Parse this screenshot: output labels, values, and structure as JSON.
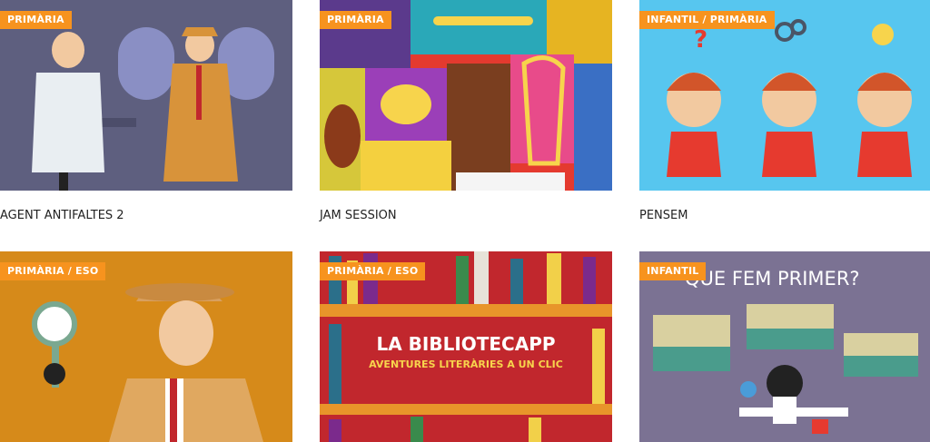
{
  "cards": [
    {
      "title": "AGENT ANTIFALTES 2",
      "badge": "PRIMÀRIA",
      "image_icon": "scientist-and-detective-illustration",
      "background": "#5e5f7f"
    },
    {
      "title": "JAM SESSION",
      "badge": "PRIMÀRIA",
      "image_icon": "musical-instruments-collage",
      "background": "#e43a2f"
    },
    {
      "title": "PENSEM",
      "badge": "INFANTIL / PRIMÀRIA",
      "image_icon": "thinking-boy-illustration",
      "background": "#57c6ef"
    },
    {
      "title": "",
      "badge": "PRIMÀRIA / ESO",
      "image_icon": "detective-with-magnifier-illustration",
      "background": "#d68a1a"
    },
    {
      "title": "",
      "badge": "PRIMÀRIA / ESO",
      "image_icon": "bookshelf-illustration",
      "background": "#c1272d",
      "image_title": "LA BIBLIOTECAPP",
      "image_subtitle": "AVENTURES LITERÀRIES A UN CLIC"
    },
    {
      "title": "",
      "badge": "INFANTIL",
      "image_icon": "kid-at-desk-illustration",
      "background": "#7b7293",
      "image_title": "QUE FEM PRIMER?"
    }
  ],
  "accent_color": "#f7931e"
}
